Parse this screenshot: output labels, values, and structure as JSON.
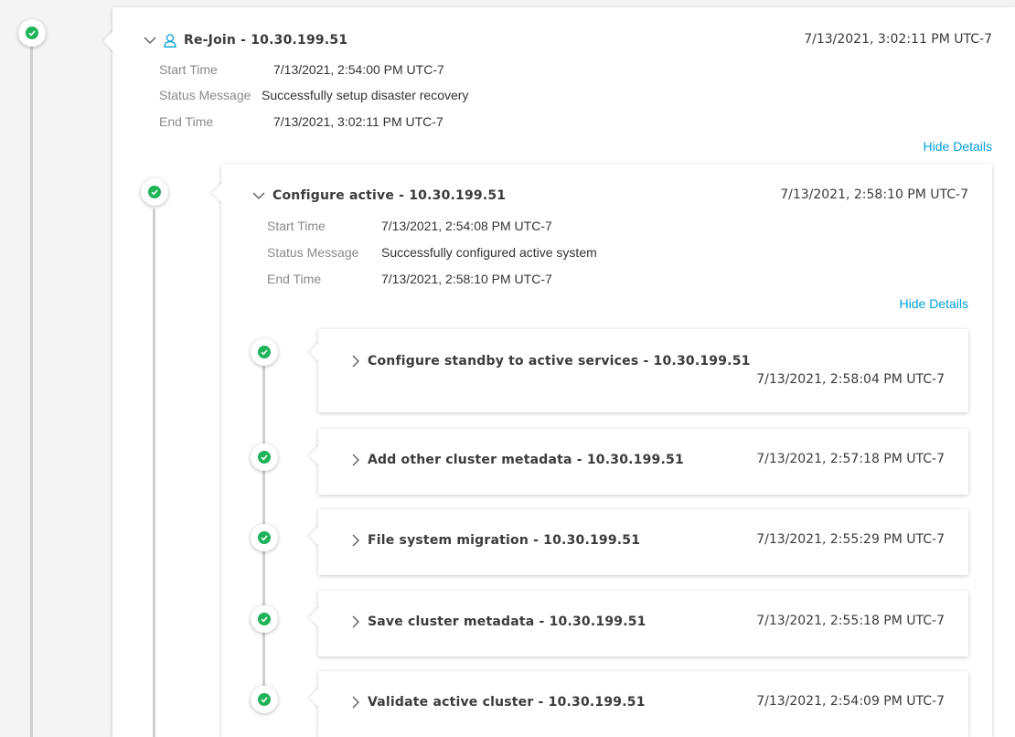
{
  "colors": {
    "success": "#1fb35a",
    "link": "#049fd9",
    "timeline": "#cfcfcf"
  },
  "rejoin": {
    "icon": "user-icon",
    "title": "Re-Join - 10.30.199.51",
    "timestamp": "7/13/2021, 3:02:11 PM UTC-7",
    "details": [
      {
        "label": "Start Time",
        "value": "7/13/2021, 2:54:00 PM UTC-7"
      },
      {
        "label": "Status Message",
        "value": "Successfully setup disaster recovery"
      },
      {
        "label": "End Time",
        "value": "7/13/2021, 3:02:11 PM UTC-7"
      }
    ],
    "hide_details": "Hide Details"
  },
  "configure_active": {
    "title": "Configure active - 10.30.199.51",
    "timestamp": "7/13/2021, 2:58:10 PM UTC-7",
    "details": [
      {
        "label": "Start Time",
        "value": "7/13/2021, 2:54:08 PM UTC-7"
      },
      {
        "label": "Status Message",
        "value": "Successfully configured active system"
      },
      {
        "label": "End Time",
        "value": "7/13/2021, 2:58:10 PM UTC-7"
      }
    ],
    "hide_details": "Hide Details"
  },
  "subtasks": [
    {
      "title": "Configure standby to active services - 10.30.199.51",
      "timestamp": "7/13/2021, 2:58:04 PM UTC-7"
    },
    {
      "title": "Add other cluster metadata - 10.30.199.51",
      "timestamp": "7/13/2021, 2:57:18 PM UTC-7"
    },
    {
      "title": "File system migration - 10.30.199.51",
      "timestamp": "7/13/2021, 2:55:29 PM UTC-7"
    },
    {
      "title": "Save cluster metadata - 10.30.199.51",
      "timestamp": "7/13/2021, 2:55:18 PM UTC-7"
    },
    {
      "title": "Validate active cluster - 10.30.199.51",
      "timestamp": "7/13/2021, 2:54:09 PM UTC-7"
    }
  ]
}
